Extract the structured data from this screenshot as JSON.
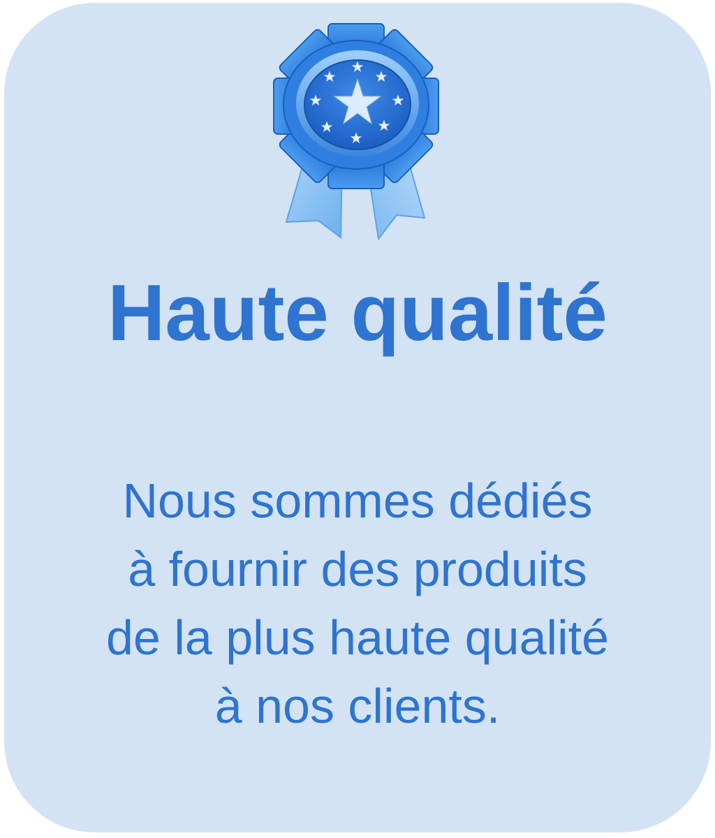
{
  "badge": {
    "icon": "award-ribbon-icon",
    "colors": {
      "ribbon": "#8fc4f2",
      "rosette": "#2f7fe0",
      "medal_center": "#2a6fd4",
      "stars": "#dfefff"
    }
  },
  "title": "Haute qualité",
  "description": {
    "lines": [
      "Nous sommes dédiés",
      "à fournir des produits",
      "de la plus haute qualité",
      "à nos clients."
    ]
  },
  "colors": {
    "card_background": "#d3e3f4",
    "text": "#2e74d0"
  }
}
